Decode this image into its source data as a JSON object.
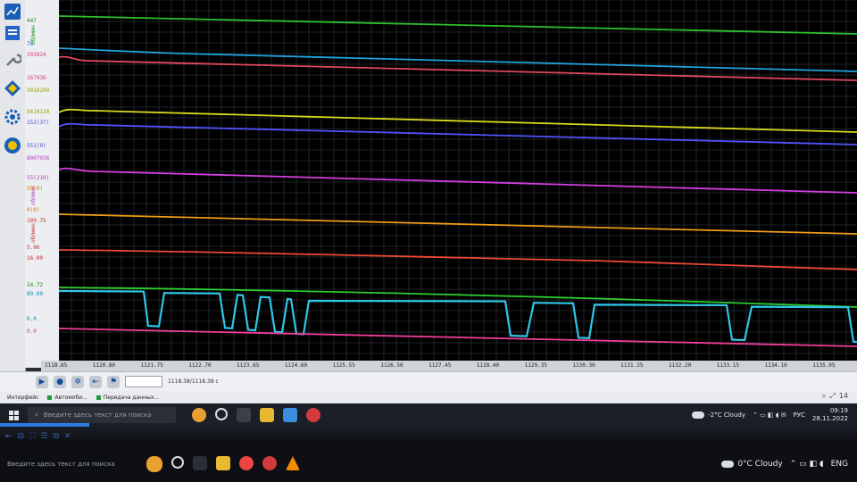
{
  "sidebar": {
    "tools": [
      {
        "name": "chart-tool-icon",
        "color": "#1a5fb4"
      },
      {
        "name": "wrench-icon",
        "color": "#6b7280"
      },
      {
        "name": "settings-gear-icon",
        "color": "#1a5fb4"
      },
      {
        "name": "diamond-tool-icon",
        "color": "#1a5fb4"
      },
      {
        "name": "brand-logo-icon",
        "color": "#f0c000"
      }
    ]
  },
  "axis_ticks": [
    {
      "text": "447",
      "color": "#1a8a1a"
    },
    {
      "text": "78",
      "color": "#1a6ea8"
    },
    {
      "text": "203824",
      "color": "#d04070"
    },
    {
      "text": "167936",
      "color": "#d04070"
    },
    {
      "text": "3010200",
      "color": "#a0a000"
    },
    {
      "text": "5610120",
      "color": "#a0a000"
    },
    {
      "text": "152(37)",
      "color": "#4a4acd"
    },
    {
      "text": "551(0)",
      "color": "#4a4acd"
    },
    {
      "text": "8007936",
      "color": "#b040c0"
    },
    {
      "text": "55(210)",
      "color": "#b040c0"
    },
    {
      "text": "39(0)",
      "color": "#d08000"
    },
    {
      "text": "0(0)",
      "color": "#d08000"
    },
    {
      "text": "109.75",
      "color": "#c03030"
    },
    {
      "text": "5.96",
      "color": "#c03030"
    },
    {
      "text": "16.00",
      "color": "#c03030"
    },
    {
      "text": "14.72",
      "color": "#1a8a1a"
    },
    {
      "text": "89.80",
      "color": "#1a8ab0"
    },
    {
      "text": "0.0",
      "color": "#1a8ab0"
    },
    {
      "text": "0.0",
      "color": "#d04090"
    }
  ],
  "axis_names": [
    {
      "text": "об/мин",
      "color": "#1a8a1a"
    },
    {
      "text": "об/мин",
      "color": "#b040c0"
    },
    {
      "text": "об/мин",
      "color": "#c03030"
    }
  ],
  "traces": [
    {
      "name": "green-trace-1",
      "color": "#2fbf2f"
    },
    {
      "name": "blue-trace",
      "color": "#21a3e0"
    },
    {
      "name": "red-trace-1",
      "color": "#e0485e"
    },
    {
      "name": "yellow-trace",
      "color": "#dada1c"
    },
    {
      "name": "indigo-trace",
      "color": "#5252ff"
    },
    {
      "name": "magenta-trace",
      "color": "#d43ee0"
    },
    {
      "name": "orange-trace",
      "color": "#ef9d14"
    },
    {
      "name": "red-trace-2",
      "color": "#ef4838"
    },
    {
      "name": "green-trace-2",
      "color": "#2fce2f"
    },
    {
      "name": "cyan-square-trace",
      "color": "#30c6e6"
    },
    {
      "name": "pink-trace",
      "color": "#ef3e9a"
    }
  ],
  "time_axis": {
    "labels": [
      "1118.85",
      "1120.80",
      "1121.75",
      "1122.70",
      "1123.65",
      "1124.60",
      "1125.55",
      "1126.50",
      "1127.45",
      "1128.40",
      "1129.35",
      "1130.30",
      "1131.25",
      "1132.20",
      "1133.15",
      "1134.10",
      "1135.05"
    ]
  },
  "toolbar": {
    "time_readout": "1118.38/1118.38 с"
  },
  "status": {
    "interface": "Интерфейс",
    "car": "Автомоби...",
    "transfer": "Передача данных...",
    "right_value": "14"
  },
  "inner_taskbar": {
    "search_placeholder": "Введите здесь текст для поиска",
    "weather": "-2°C Cloudy",
    "lang": "РУС",
    "time": "09:19",
    "date": "28.11.2022"
  },
  "outer_taskbar": {
    "search_placeholder": "Введите здесь текст для поиска",
    "weather": "0°C Cloudy",
    "lang": "ENG"
  },
  "colors": {
    "plot_bg": "#000000",
    "grid": "#3a3f46",
    "taskbar": "#1b1f27"
  }
}
